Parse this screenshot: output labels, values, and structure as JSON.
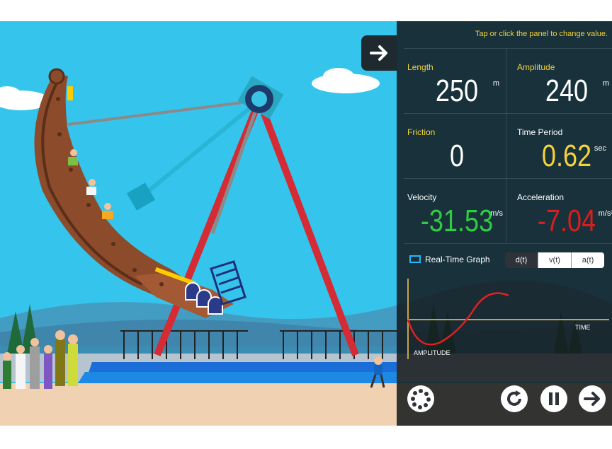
{
  "panel": {
    "hint": "Tap or click the panel to change value.",
    "length": {
      "label": "Length",
      "value": "250",
      "unit": "m"
    },
    "amplitude": {
      "label": "Amplitude",
      "value": "240",
      "unit": "m"
    },
    "friction": {
      "label": "Friction",
      "value": "0"
    },
    "time_period": {
      "label": "Time Period",
      "value": "0.62",
      "unit": "sec"
    },
    "velocity": {
      "label": "Velocity",
      "value": "-31.53",
      "unit": "m/s"
    },
    "acceleration": {
      "label": "Acceleration",
      "value": "-7.04",
      "unit": "m/s²"
    },
    "graph_title": "Real-Time Graph",
    "tabs": [
      "d(t)",
      "v(t)",
      "a(t)"
    ],
    "active_tab": "d(t)",
    "graph_time_label": "TIME",
    "graph_amplitude_label": "AMPLITUDE"
  },
  "colors": {
    "label_yellow": "#f3d23b",
    "value_white": "#ffffff",
    "value_yellow": "#f3d23b",
    "value_green": "#2ecc40",
    "value_red": "#d81e1e",
    "graph_curve": "#e02020"
  },
  "controls": [
    "expand-arrow-icon",
    "settings-dots-icon",
    "reset-icon",
    "pause-icon",
    "next-arrow-icon"
  ]
}
